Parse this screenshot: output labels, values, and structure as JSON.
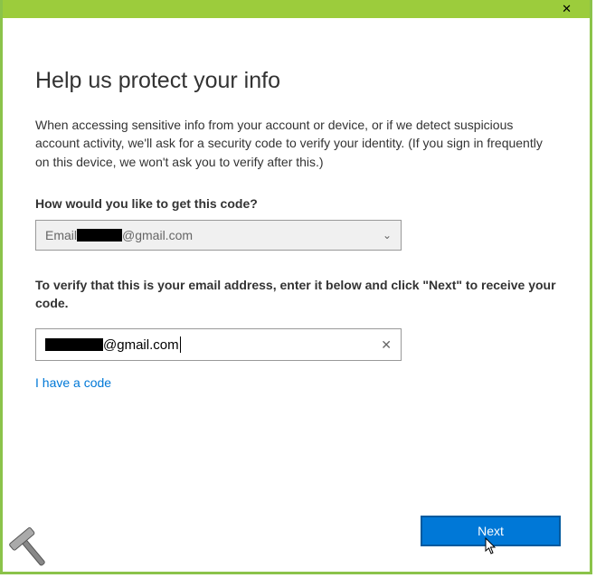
{
  "titlebar": {
    "close_label": "✕"
  },
  "page": {
    "title": "Help us protect your info",
    "description": "When accessing sensitive info from your account or device, or if we detect suspicious account activity, we'll ask for a security code to verify your identity. (If you sign in frequently on this device, we won't ask you to verify after this.)",
    "method_label": "How would you like to get this code?",
    "dropdown": {
      "prefix": "Email ",
      "suffix": "@gmail.com"
    },
    "verify_label": "To verify that this is your email address, enter it below and click \"Next\" to receive your code.",
    "input": {
      "suffix": "@gmail.com"
    },
    "have_code_link": "I have a code",
    "next_button": "Next"
  },
  "icons": {
    "chevron_down": "⌄",
    "clear": "✕"
  }
}
